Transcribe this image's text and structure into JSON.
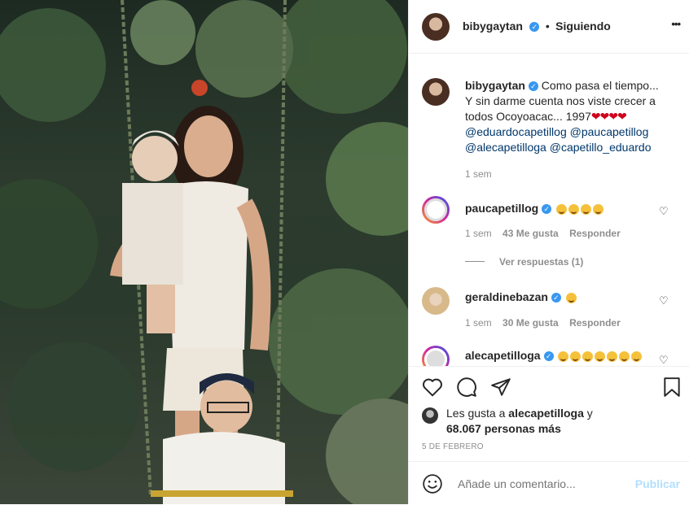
{
  "post": {
    "username": "bibygaytan",
    "follow_label": "Siguiendo",
    "more_label": "•••",
    "caption_line1": "Como pasa el tiempo...",
    "caption_line2": "Y sin darme cuenta nos viste crecer a",
    "caption_line3": "todos Ocoyoacac... 1997",
    "caption_hearts": "❤❤❤❤",
    "mentions_line1": [
      "@eduardocapetillog",
      "@paucapetillog"
    ],
    "mentions_line2": [
      "@alecapetilloga",
      "@capetillo_eduardo"
    ],
    "time": "1 sem"
  },
  "comments": [
    {
      "username": "paucapetillog",
      "emoji_count": 4,
      "time": "1 sem",
      "likes": "43 Me gusta",
      "reply": "Responder",
      "view_replies": "Ver respuestas (1)"
    },
    {
      "username": "geraldinebazan",
      "emoji_count": 1,
      "time": "1 sem",
      "likes": "30 Me gusta",
      "reply": "Responder"
    },
    {
      "username": "alecapetilloga",
      "emoji_count": 7
    }
  ],
  "likes": {
    "prefix": "Les gusta a",
    "user": "alecapetilloga",
    "conj": "y",
    "count": "68.067 personas más"
  },
  "date": "5 DE FEBRERO",
  "add_comment": {
    "placeholder": "Añade un comentario...",
    "publish": "Publicar"
  },
  "icons": {
    "like": "heart-icon",
    "comment": "comment-icon",
    "share": "paper-plane-icon",
    "save": "bookmark-icon",
    "emoji": "smiley-icon",
    "verified": "verified-badge-icon"
  },
  "colors": {
    "accent": "#3897f0",
    "mention": "#00376b",
    "publish_disabled": "#b2dffc",
    "secondary": "#8e8e8e"
  }
}
